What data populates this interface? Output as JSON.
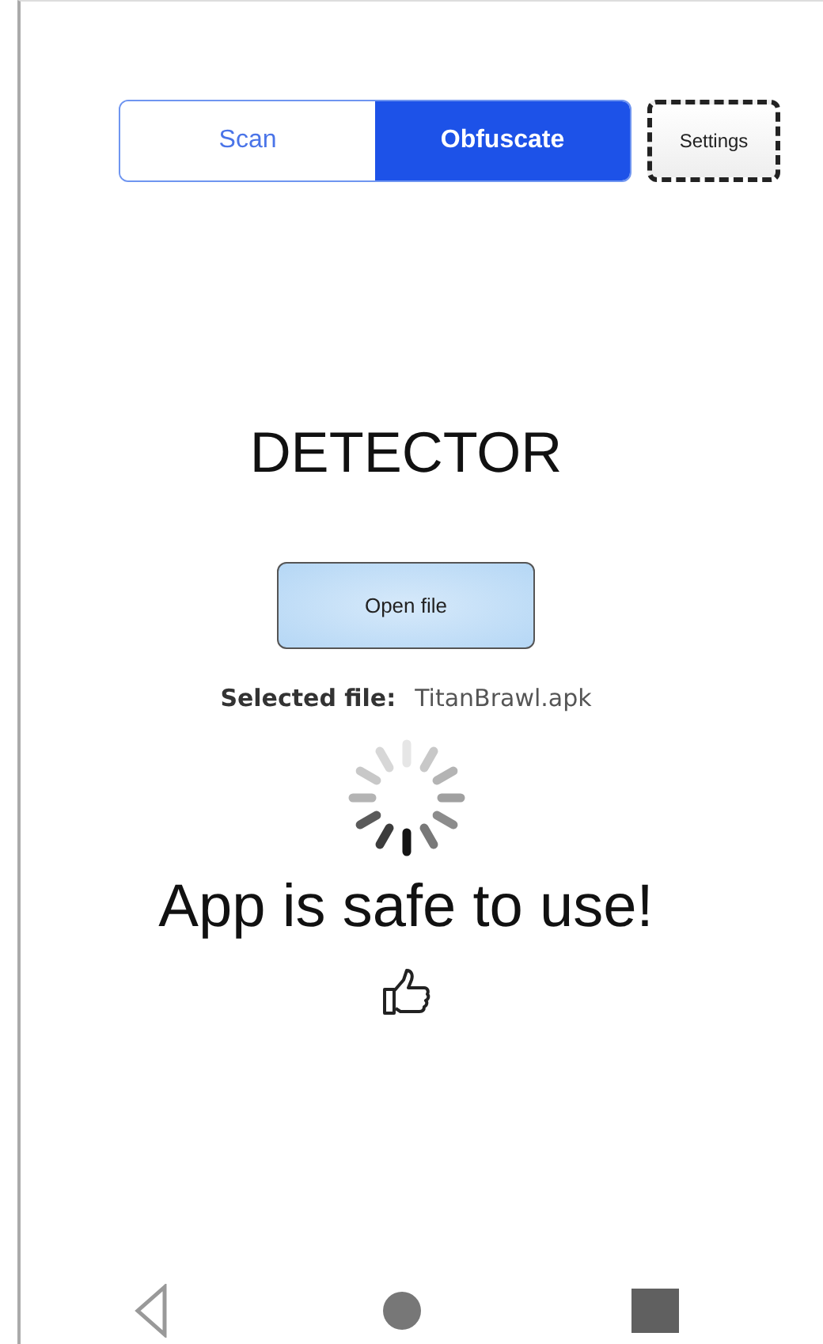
{
  "tabs": [
    {
      "label": "Scan",
      "selected": false
    },
    {
      "label": "Obfuscate",
      "selected": true
    }
  ],
  "settings_button": {
    "label": "Settings"
  },
  "title": "DETECTOR",
  "open_file_button": {
    "label": "Open file"
  },
  "selected_file": {
    "label": "Selected file:",
    "value": "TitanBrawl.apk"
  },
  "result": "App is safe to use!"
}
